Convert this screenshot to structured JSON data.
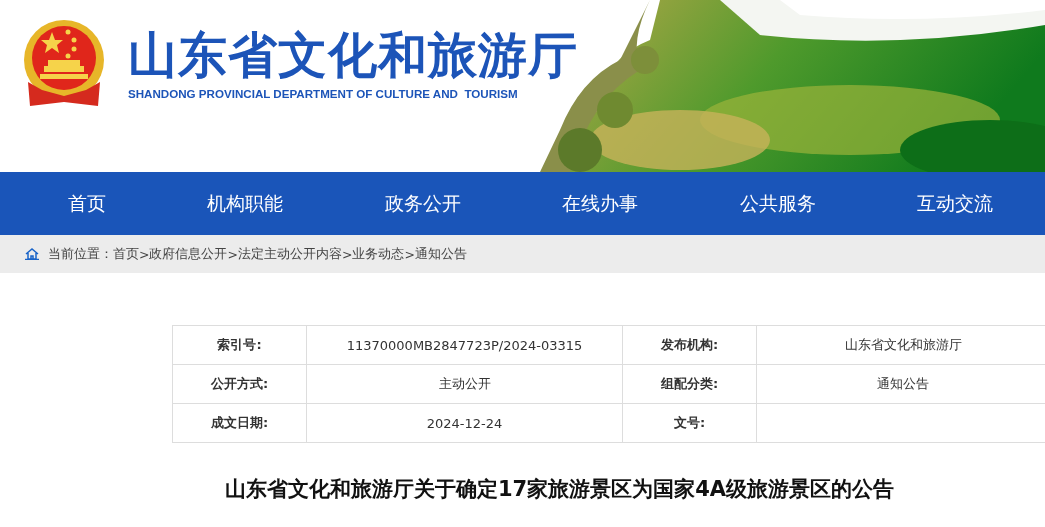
{
  "header": {
    "title": "山东省文化和旅游厅",
    "subtitle": "SHANDONG PROVINCIAL DEPARTMENT OF CULTURE AND  TOURISM"
  },
  "nav": [
    {
      "label": "首页"
    },
    {
      "label": "机构职能"
    },
    {
      "label": "政务公开"
    },
    {
      "label": "在线办事"
    },
    {
      "label": "公共服务"
    },
    {
      "label": "互动交流"
    }
  ],
  "breadcrumb": {
    "label": "当前位置：",
    "separator": ">",
    "items": [
      "首页",
      "政府信息公开",
      "法定主动公开内容",
      "业务动态",
      "通知公告"
    ]
  },
  "info_table": {
    "rows": [
      [
        {
          "label": "索引号:",
          "value": "11370000MB2847723P/2024-03315"
        },
        {
          "label": "发布机构:",
          "value": "山东省文化和旅游厅"
        }
      ],
      [
        {
          "label": "公开方式:",
          "value": "主动公开"
        },
        {
          "label": "组配分类:",
          "value": "通知公告"
        }
      ],
      [
        {
          "label": "成文日期:",
          "value": "2024-12-24"
        },
        {
          "label": "文号:"
        }
      ]
    ]
  },
  "article": {
    "title": "山东省文化和旅游厅关于确定17家旅游景区为国家4A级旅游景区的公告"
  }
}
